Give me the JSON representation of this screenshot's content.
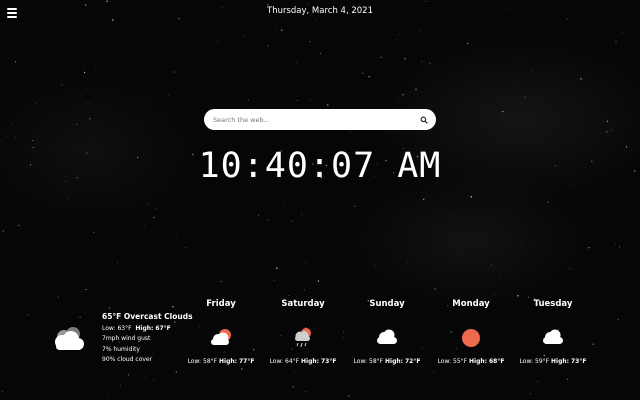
{
  "header": {
    "date": "Thursday, March 4, 2021"
  },
  "search": {
    "placeholder": "Search the web..."
  },
  "clock": {
    "time": "10:40:07 AM"
  },
  "current": {
    "icon": "cloud-icon",
    "condition": "65°F Overcast Clouds",
    "low_label": "Low:",
    "low_value": "63°F",
    "high_label": "High:",
    "high_value": "67°F",
    "wind": "7mph wind gust",
    "humidity": "7% humidity",
    "cloud_cover": "90% cloud cover"
  },
  "forecast": [
    {
      "day": "Friday",
      "icon": "partly-cloudy-icon",
      "low_label": "Low:",
      "low": "58°F",
      "high_label": "High:",
      "high": "77°F"
    },
    {
      "day": "Saturday",
      "icon": "rain-icon",
      "low_label": "Low:",
      "low": "64°F",
      "high_label": "High:",
      "high": "73°F"
    },
    {
      "day": "Sunday",
      "icon": "cloud-icon",
      "low_label": "Low:",
      "low": "58°F",
      "high_label": "High:",
      "high": "72°F"
    },
    {
      "day": "Monday",
      "icon": "sun-icon",
      "low_label": "Low:",
      "low": "55°F",
      "high_label": "High:",
      "high": "68°F"
    },
    {
      "day": "Tuesday",
      "icon": "cloud-icon",
      "low_label": "Low:",
      "low": "59°F",
      "high_label": "High:",
      "high": "73°F"
    }
  ],
  "colors": {
    "sun": "#ee6a4f",
    "cloud": "#ffffff",
    "cloud_shade": "#bfbfbf",
    "background": "#060606"
  }
}
